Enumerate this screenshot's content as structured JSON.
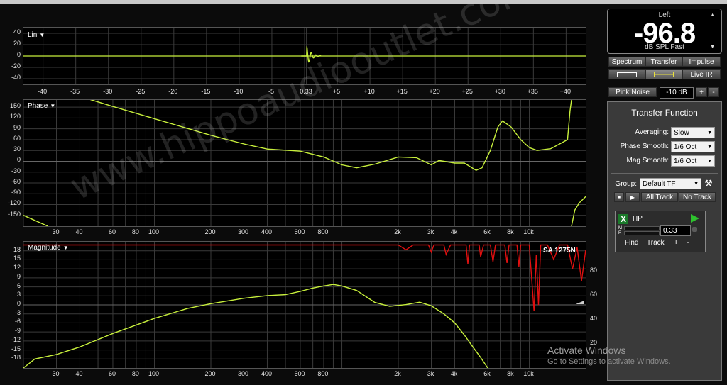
{
  "lin_panel": {
    "title": "Lin",
    "y_ticks": [
      "40",
      "20",
      "0",
      "-20",
      "-40"
    ],
    "x_ticks": [
      "-40",
      "-35",
      "-30",
      "-25",
      "-20",
      "-15",
      "-10",
      "-5",
      "0.33",
      "+5",
      "+10",
      "+15",
      "+20",
      "+25",
      "+30",
      "+35",
      "+40"
    ]
  },
  "phase_panel": {
    "title": "Phase",
    "y_ticks": [
      "150",
      "120",
      "90",
      "60",
      "30",
      "0",
      "-30",
      "-60",
      "-90",
      "-120",
      "-150"
    ]
  },
  "magnitude_panel": {
    "title": "Magnitude",
    "y_ticks": [
      "18",
      "15",
      "12",
      "9",
      "6",
      "3",
      "0",
      "-3",
      "-6",
      "-9",
      "-12",
      "-15",
      "-18"
    ],
    "coherence_ticks": [
      "80",
      "60",
      "40",
      "20"
    ],
    "trace_label": "SA 1275N"
  },
  "freq_ticks": [
    "30",
    "40",
    "60",
    "80",
    "100",
    "200",
    "300",
    "400",
    "600",
    "800",
    "2k",
    "3k",
    "4k",
    "6k",
    "8k",
    "10k"
  ],
  "meter": {
    "channel": "Left",
    "value": "-96.8",
    "unit": "dB SPL Fast"
  },
  "mode_buttons": [
    "Spectrum",
    "Transfer",
    "Impulse"
  ],
  "live_ir_label": "Live IR",
  "pink_noise": {
    "label": "Pink Noise",
    "level": "-10 dB",
    "plus": "+",
    "minus": "-"
  },
  "transfer_function": {
    "title": "Transfer Function",
    "averaging_label": "Averaging:",
    "averaging_value": "Slow",
    "phase_smooth_label": "Phase Smooth:",
    "phase_smooth_value": "1/6 Oct",
    "mag_smooth_label": "Mag Smooth:",
    "mag_smooth_value": "1/6 Oct",
    "group_label": "Group:",
    "group_value": "Default TF",
    "all_track": "All Track",
    "no_track": "No Track",
    "track": {
      "enabled_mark": "X",
      "name": "HP",
      "meter_m": "M",
      "meter_r": "R",
      "delay_value": "0.33",
      "find": "Find",
      "track": "Track",
      "plus": "+",
      "minus": "-"
    }
  },
  "watermark": "www.hippoaudiooutlet.com",
  "windows_notice": {
    "title": "Activate Windows",
    "subtitle": "Go to Settings to activate Windows."
  },
  "colors": {
    "trace": "#c8f03c",
    "coherence": "#e01010",
    "grid": "#3a3a3a",
    "panel_bg": "#3a3a3a"
  }
}
